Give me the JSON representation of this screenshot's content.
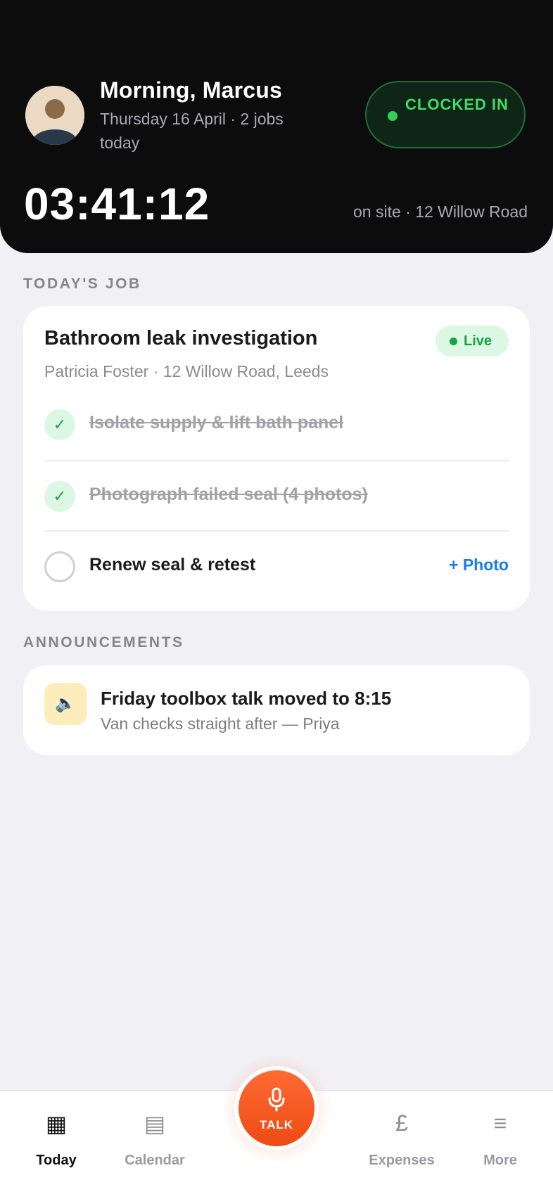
{
  "header": {
    "greeting": "Morning, Marcus",
    "subline": "Thursday 16 April · 2 jobs today",
    "status": "CLOCKED IN",
    "status_color": "#3fdc68",
    "timer": "03:41:12",
    "location": "on site · 12 Willow Road"
  },
  "todays_job": {
    "section_label": "TODAY'S JOB",
    "title": "Bathroom leak investigation",
    "subtitle": "Patricia Foster · 12 Willow Road, Leeds",
    "badge": "Live",
    "tasks": [
      {
        "label": "Isolate supply & lift bath panel",
        "done": true
      },
      {
        "label": "Photograph failed seal (4 photos)",
        "done": true
      },
      {
        "label": "Renew seal & retest",
        "done": false,
        "action": "+ Photo"
      }
    ]
  },
  "announcements": {
    "section_label": "ANNOUNCEMENTS",
    "items": [
      {
        "title": "Friday toolbox talk moved to 8:15",
        "subtitle": "Van checks straight after — Priya",
        "icon": "speaker-icon"
      }
    ]
  },
  "tabbar": {
    "tabs": [
      {
        "label": "Today",
        "icon": "grid-icon",
        "active": true
      },
      {
        "label": "Calendar",
        "icon": "calendar-icon",
        "active": false
      },
      {
        "label": "Expenses",
        "icon": "pound-icon",
        "active": false
      },
      {
        "label": "More",
        "icon": "menu-icon",
        "active": false
      }
    ],
    "talk_label": "TALK",
    "accent": "#ee4a14"
  }
}
